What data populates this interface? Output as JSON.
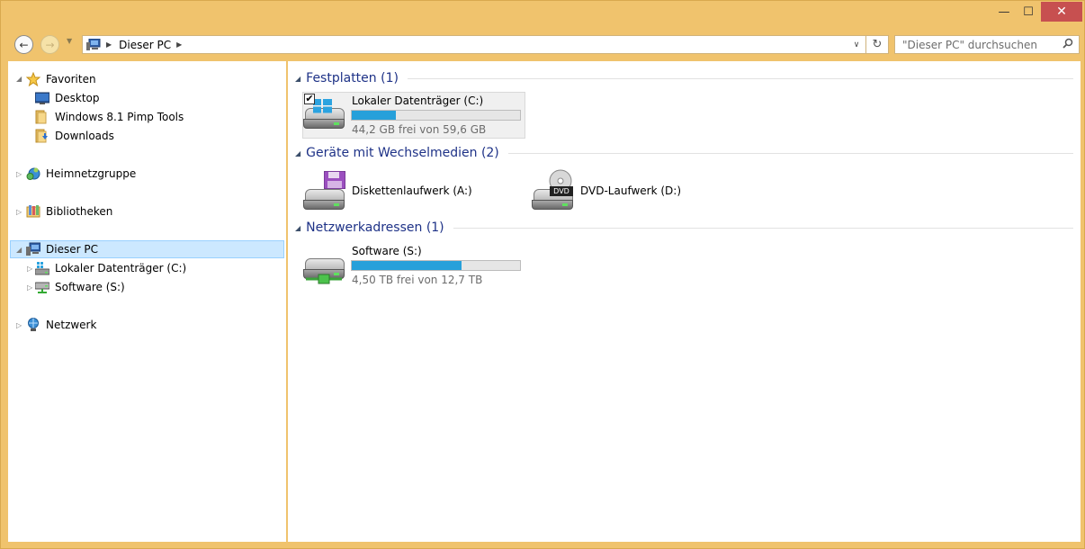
{
  "window": {
    "minimize_glyph": "—",
    "maximize_glyph": "☐",
    "close_glyph": "✕"
  },
  "nav": {
    "back_glyph": "←",
    "forward_glyph": "→",
    "history_glyph": "▼",
    "breadcrumb": [
      "Dieser PC"
    ],
    "address_sep": "▶",
    "dropdown_glyph": "∨",
    "refresh_glyph": "↻",
    "search_placeholder": "\"Dieser PC\" durchsuchen",
    "search_icon": "search-icon"
  },
  "tree": {
    "favorites": {
      "label": "Favoriten",
      "icon": "star-icon"
    },
    "favorites_items": [
      {
        "label": "Desktop",
        "icon": "desktop-icon"
      },
      {
        "label": "Windows 8.1 Pimp Tools",
        "icon": "folder-icon"
      },
      {
        "label": "Downloads",
        "icon": "downloads-folder-icon"
      }
    ],
    "homegroup": {
      "label": "Heimnetzgruppe",
      "icon": "homegroup-icon"
    },
    "libraries": {
      "label": "Bibliotheken",
      "icon": "libraries-icon"
    },
    "this_pc": {
      "label": "Dieser PC",
      "icon": "computer-icon"
    },
    "this_pc_items": [
      {
        "label": "Lokaler Datenträger (C:)",
        "icon": "windows-drive-icon"
      },
      {
        "label": "Software (S:)",
        "icon": "network-drive-icon"
      }
    ],
    "network": {
      "label": "Netzwerk",
      "icon": "network-icon"
    }
  },
  "groups": [
    {
      "title": "Festplatten (1)"
    },
    {
      "title": "Geräte mit Wechselmedien (2)"
    },
    {
      "title": "Netzwerkadressen (1)"
    }
  ],
  "drives": {
    "c": {
      "name": "Lokaler Datenträger (C:)",
      "info": "44,2 GB frei von 59,6 GB",
      "used_fraction": 0.26,
      "checked": true
    },
    "a": {
      "name": "Diskettenlaufwerk (A:)"
    },
    "d": {
      "name": "DVD-Laufwerk (D:)",
      "badge": "DVD"
    },
    "s": {
      "name": "Software (S:)",
      "info": "4,50 TB frei von 12,7 TB",
      "used_fraction": 0.65
    }
  },
  "colors": {
    "frame": "#f0c36d",
    "selection": "#cce8ff",
    "group_title": "#1e3287",
    "bar_fill": "#26a0da",
    "close": "#c75050"
  }
}
